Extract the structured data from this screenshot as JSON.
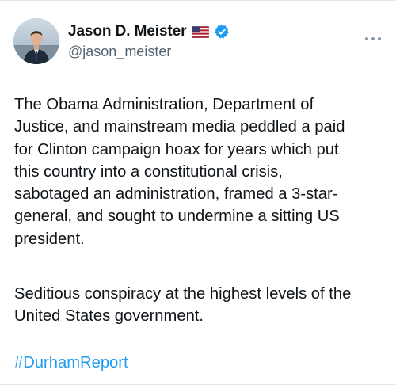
{
  "tweet": {
    "author": {
      "display_name": "Jason D. Meister",
      "handle": "@jason_meister",
      "flag_icon": "us-flag-icon",
      "verified_icon": "verified-badge-icon",
      "verified_color": "#1d9bf0"
    },
    "more_icon": "more-options-icon",
    "body_paragraph_1": "The Obama Administration, Department of\nJustice, and mainstream media peddled a paid\nfor Clinton campaign hoax for years which put\nthis country into a constitutional crisis,\nsabotaged an administration, framed a 3-star-\ngeneral, and sought to undermine a sitting US\npresident.",
    "body_paragraph_2": "Seditious conspiracy at the highest levels of the\nUnited States government.",
    "hashtag": "#DurhamReport",
    "hashtag_color": "#1d9bf0"
  }
}
